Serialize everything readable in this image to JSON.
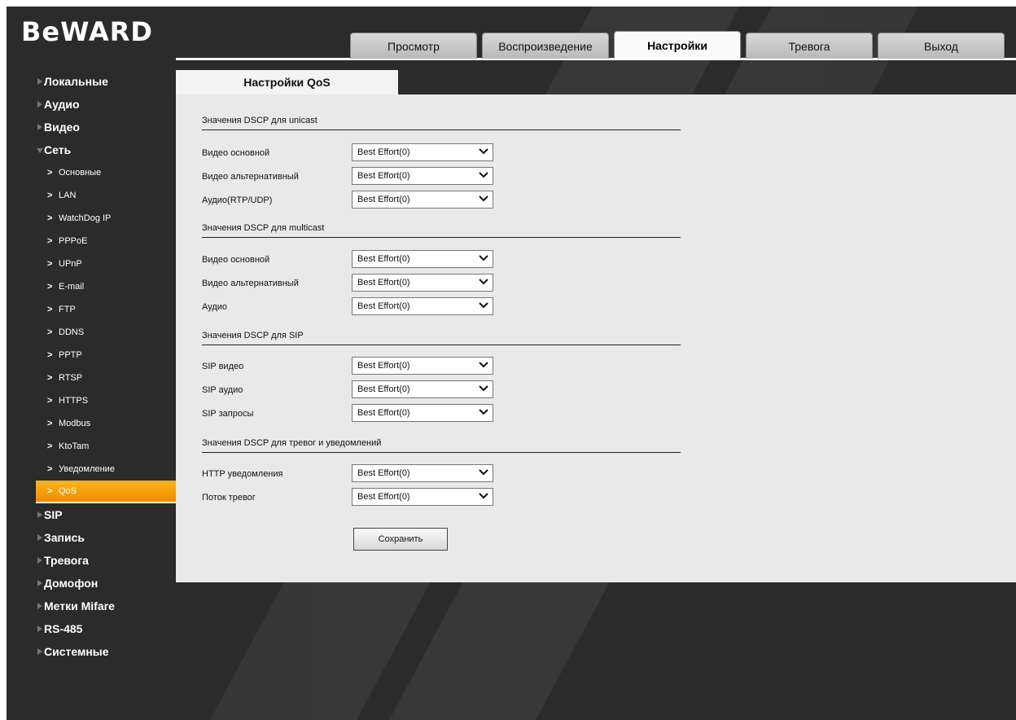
{
  "header": {
    "logo": "BeWARD",
    "tabs": [
      {
        "label": "Просмотр"
      },
      {
        "label": "Воспроизведение"
      },
      {
        "label": "Настройки"
      },
      {
        "label": "Тревога"
      },
      {
        "label": "Выход"
      }
    ],
    "active_tab": "Настройки"
  },
  "sidebar": {
    "items": [
      {
        "label": "Локальные"
      },
      {
        "label": "Аудио"
      },
      {
        "label": "Видео"
      },
      {
        "label": "Сеть"
      },
      {
        "label": "SIP"
      },
      {
        "label": "Запись"
      },
      {
        "label": "Тревога"
      },
      {
        "label": "Домофон"
      },
      {
        "label": "Метки Mifare"
      },
      {
        "label": "RS-485"
      },
      {
        "label": "Системные"
      }
    ],
    "network_subitems": [
      {
        "label": "Основные"
      },
      {
        "label": "LAN"
      },
      {
        "label": "WatchDog IP"
      },
      {
        "label": "PPPoE"
      },
      {
        "label": "UPnP"
      },
      {
        "label": "E-mail"
      },
      {
        "label": "FTP"
      },
      {
        "label": "DDNS"
      },
      {
        "label": "PPTP"
      },
      {
        "label": "RTSP"
      },
      {
        "label": "HTTPS"
      },
      {
        "label": "Modbus"
      },
      {
        "label": "KtoTam"
      },
      {
        "label": "Уведомление"
      },
      {
        "label": "QoS"
      }
    ],
    "active_subitem": "QoS"
  },
  "content": {
    "tab_title": "Настройки QoS",
    "sections": [
      {
        "title": "Значения DSCP для unicast",
        "rows": [
          {
            "label": "Видео основной",
            "value": "Best Effort(0)"
          },
          {
            "label": "Видео альтернативный",
            "value": "Best Effort(0)"
          },
          {
            "label": "Аудио(RTP/UDP)",
            "value": "Best Effort(0)"
          }
        ]
      },
      {
        "title": "Значения DSCP для multicast",
        "rows": [
          {
            "label": "Видео основной",
            "value": "Best Effort(0)"
          },
          {
            "label": "Видео альтернативный",
            "value": "Best Effort(0)"
          },
          {
            "label": "Аудио",
            "value": "Best Effort(0)"
          }
        ]
      },
      {
        "title": "Значения DSCP для SIP",
        "rows": [
          {
            "label": "SIP видео",
            "value": "Best Effort(0)"
          },
          {
            "label": "SIP аудио",
            "value": "Best Effort(0)"
          },
          {
            "label": "SIP запросы",
            "value": "Best Effort(0)"
          }
        ]
      },
      {
        "title": "Значения DSCP для тревог и уведомлений",
        "rows": [
          {
            "label": "HTTP уведомления",
            "value": "Best Effort(0)"
          },
          {
            "label": "Поток тревог",
            "value": "Best Effort(0)"
          }
        ]
      }
    ],
    "save_label": "Сохранить"
  },
  "colors": {
    "background": "#2b2b2b",
    "panel": "#e9e9e9",
    "accent_orange": "#f5a00f"
  },
  "icons": {
    "tree_collapsed": "triangle-right-icon",
    "tree_expanded": "triangle-down-icon",
    "subitem": "chevron-right-icon",
    "select_arrow": "chevron-down-icon"
  }
}
